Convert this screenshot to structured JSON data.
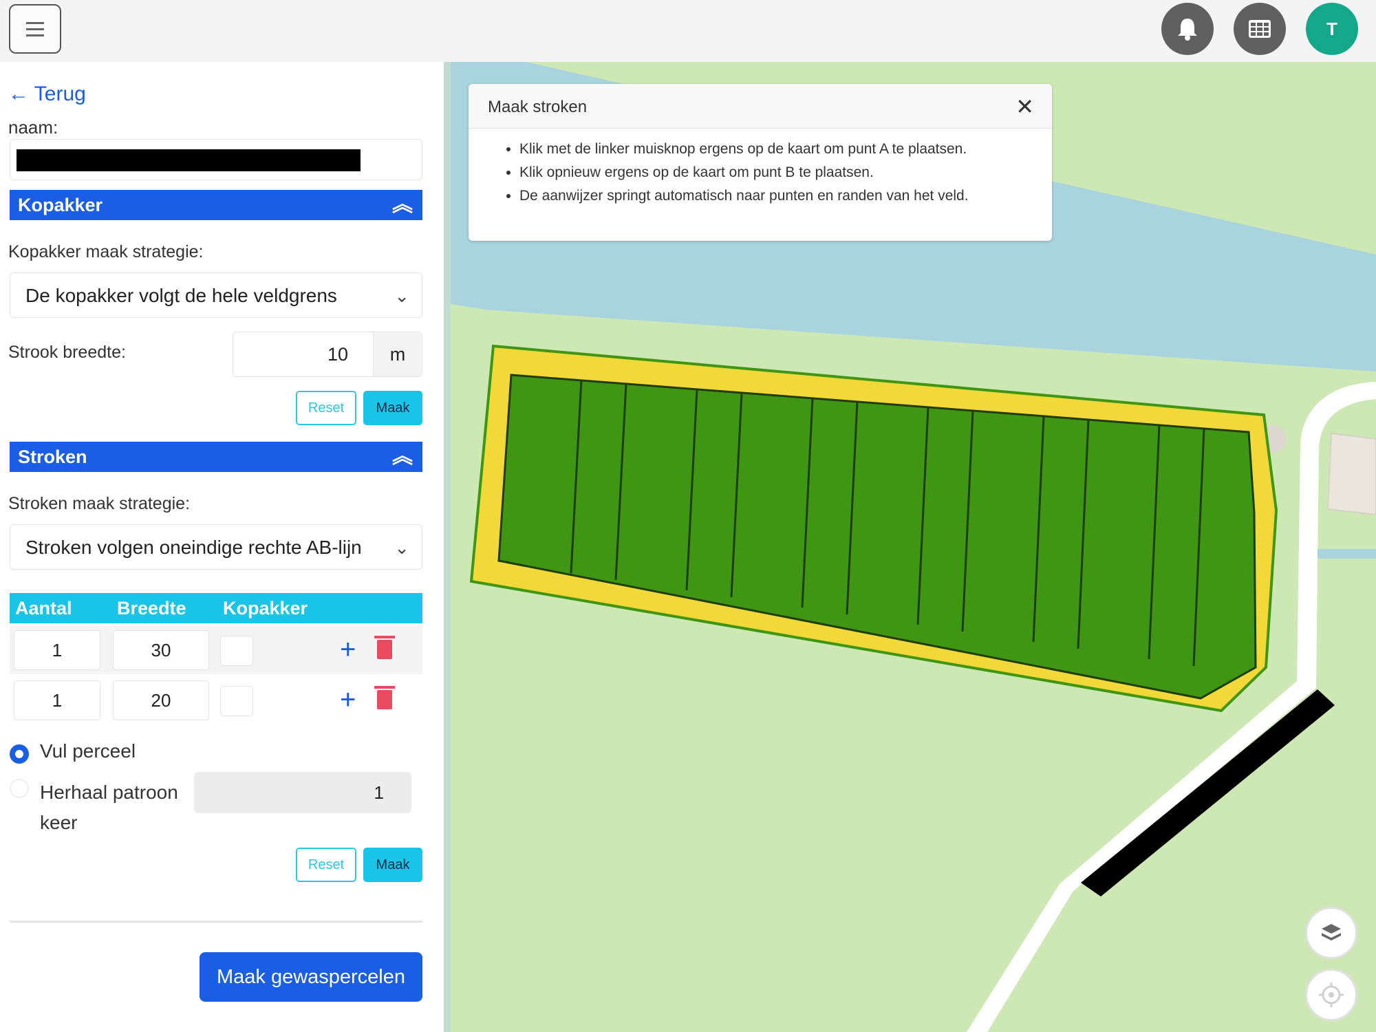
{
  "topbar": {
    "avatar_initial": "T"
  },
  "sidebar": {
    "back_label": "← Terug",
    "name_label": "naam:",
    "kopakker": {
      "title": "Kopakker",
      "strategy_label": "Kopakker maak strategie:",
      "strategy_value": "De kopakker volgt de hele veldgrens",
      "width_label": "Strook breedte:",
      "width_value": "10",
      "width_unit": "m",
      "reset_label": "Reset",
      "make_label": "Maak"
    },
    "stroken": {
      "title": "Stroken",
      "strategy_label": "Stroken maak strategie:",
      "strategy_value": "Stroken volgen oneindige rechte AB-lijn",
      "columns": [
        "Aantal",
        "Breedte",
        "Kopakker"
      ],
      "rows": [
        {
          "aantal": "1",
          "breedte": "30"
        },
        {
          "aantal": "1",
          "breedte": "20"
        }
      ],
      "fill_label": "Vul perceel",
      "repeat_label": "Herhaal patroon",
      "repeat_label2": "keer",
      "repeat_value": "1",
      "reset_label": "Reset",
      "make_label": "Maak"
    },
    "primary_button": "Maak gewaspercelen"
  },
  "popup": {
    "title": "Maak stroken",
    "close": "✕",
    "items": [
      "Klik met de linker muisknop ergens op de kaart om punt A te plaatsen.",
      "Klik opnieuw ergens op de kaart om punt B te plaatsen.",
      "De aanwijzer springt automatisch naar punten en randen van het veld."
    ]
  },
  "map": {
    "icons": [
      "layers-icon",
      "locate-icon"
    ],
    "colors": {
      "water": "#a9d3df",
      "grass": "#cde8b4",
      "field": "#3e9612",
      "headland": "#f3d83a"
    }
  }
}
